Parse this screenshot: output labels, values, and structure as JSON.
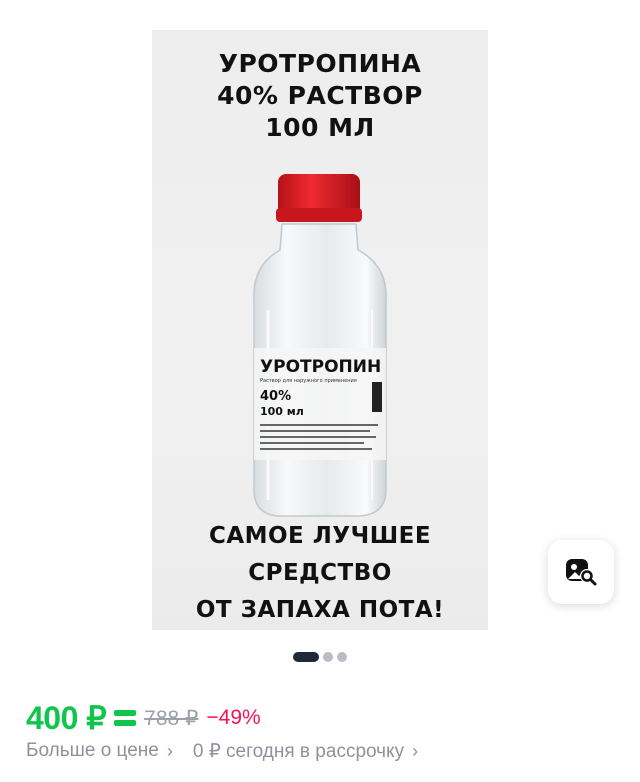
{
  "product": {
    "headline_top": [
      "УРОТРОПИНА",
      "40% РАСТВОР",
      "100 МЛ"
    ],
    "headline_bottom": [
      "САМОЕ ЛУЧШЕЕ",
      "СРЕДСТВО",
      "ОТ ЗАПАХА ПОТА!"
    ],
    "label": {
      "title": "УРОТРОПИН",
      "subtitle": "Раствор для наружного применения",
      "concentration": "40%",
      "volume": "100 мл"
    }
  },
  "carousel": {
    "total_dots": 3,
    "active_index": 0
  },
  "price": {
    "current": "400 ₽",
    "old": "788 ₽",
    "discount": "−49%"
  },
  "info": {
    "more_about_price": "Больше о цене",
    "installment": "0 ₽ сегодня в рассрочку"
  },
  "icons": {
    "visual_search": "visual-search-icon",
    "wallet": "wallet-icon",
    "chevron": "chevron-right-icon"
  },
  "colors": {
    "price_green": "#10c44c",
    "discount_pink": "#f91155",
    "cap_red": "#e11b22",
    "muted_text": "#8e929c"
  }
}
